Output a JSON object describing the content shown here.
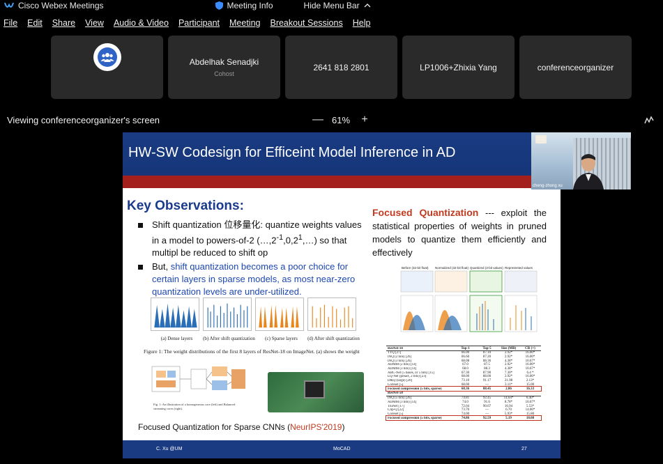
{
  "titlebar": {
    "app_name": "Cisco Webex Meetings",
    "meeting_info": "Meeting Info",
    "hide_menu": "Hide Menu Bar"
  },
  "menubar": [
    {
      "label": "File"
    },
    {
      "label": "Edit"
    },
    {
      "label": "Share"
    },
    {
      "label": "View"
    },
    {
      "label": "Audio & Video"
    },
    {
      "label": "Participant"
    },
    {
      "label": "Meeting"
    },
    {
      "label": "Breakout Sessions"
    },
    {
      "label": "Help"
    }
  ],
  "participants": [
    {
      "name": "",
      "role": "",
      "icon": "group-icon"
    },
    {
      "name": "Abdelhak Senadjki",
      "role": "Cohost"
    },
    {
      "name": "2641 818 2801",
      "role": ""
    },
    {
      "name": "LP1006+Zhixia Yang",
      "role": ""
    },
    {
      "name": "conferenceorganizer",
      "role": ""
    }
  ],
  "viewbar": {
    "viewing_text": "Viewing conferenceorganizer's screen",
    "zoom_minus": "—",
    "zoom_level": "61%",
    "zoom_plus": "+"
  },
  "slide": {
    "title": "HW-SW Codesign for Efficeint Model Inference in AD",
    "key_observations": "Key Observations:",
    "bullet1_a": "Shift quantization 位移量化: quantize weights values in a model to powers-of-2 (…,2",
    "bullet1_sup1": "-1",
    "bullet1_b": ",0,2",
    "bullet1_sup2": "1",
    "bullet1_c": ",…) so that multipl be reduced to shift op",
    "bullet2_a": "But, ",
    "bullet2_b": "shift quantization becomes a poor choice for certain layers in sparse models, as most near-zero quantization levels are under-utilized.",
    "fq_title": "Focused Quantization",
    "fq_text": " --- exploit the statistical properties of weights in pruned models to quantize them efficiently and effectively",
    "fig_captions": [
      "(a) Dense layers",
      "(b) After shift quantization",
      "(c) Sparse layers",
      "(d) After shift quantization"
    ],
    "fig_caption": "Figure 1:  The weight distributions of the first 8 layers of ResNet-18 on ImageNet. (a) shows the weight",
    "diagram_caption": "Fig. 1: An illustration of a homogeneous core (left) and Balanced streaming cores (right).",
    "fqs_text": "Focused Quantization for Sparse CNNs (",
    "fqs_venue": "NeurIPS'2019",
    "fqs_close": ")",
    "footer_left": "C. Xu @UM",
    "footer_mid": "MoCAD",
    "footer_right": "27"
  },
  "quant_fig_labels": [
    "Before (32-bit float)",
    "Normalized (32-bit float)",
    "Quantized (3-bit values)",
    "Represented values"
  ],
  "table": {
    "headers1": [
      "ResNet-18",
      "Top-1",
      "Top-5",
      "Size (MB)",
      "CR (×)"
    ],
    "rows1": [
      [
        "TTQ [27]",
        "66.00",
        "87.10",
        "2.92*",
        "16.00*"
      ],
      [
        "INQ (2 bits) [26]",
        "66.60",
        "87.20",
        "2.92*",
        "16.00*"
      ],
      [
        "INQ (3 bits) [26]",
        "68.08",
        "88.36",
        "4.38*",
        "10.67*"
      ],
      [
        "ADMM (2 bits) [14]",
        "67.0",
        "87.5",
        "2.92*",
        "16.00*"
      ],
      [
        "ADMM (3 bits) [14]",
        "68.0",
        "88.3",
        "4.38*",
        "10.67*"
      ],
      [
        "ABC-Net (5 bases, or 5 bits) [15]",
        "67.30",
        "87.90",
        "7.30*",
        "6.4 *"
      ],
      [
        "LQ-Net (preact, 2 bits) [23]",
        "68.00",
        "88.00",
        "2.92*",
        "16.00*"
      ],
      [
        "D&Q (large) [20]",
        "73.10",
        "91.17",
        "21.98",
        "2.13*"
      ],
      [
        "Coreset [5]",
        "68.00",
        "—",
        "3.11*",
        "15.00"
      ]
    ],
    "highlight1": [
      "Focused compression (5 bits, sparse)",
      "68.36",
      "88.45",
      "2.86",
      "16.33"
    ],
    "headers2": [
      "ResNet-50",
      "",
      "",
      "",
      ""
    ],
    "rows2": [
      [
        "INQ (5 bits) [26]",
        "74.81",
        "92.45",
        "14.64*",
        "6.40*"
      ],
      [
        "ADMM (3 bits) [14]",
        "74.0",
        "91.6",
        "8.78*",
        "10.67*"
      ],
      [
        "ThiNet [17]",
        "72.04",
        "90.67",
        "16.94",
        "5.53*"
      ],
      [
        "Clip-Q [22]",
        "73.70",
        "—",
        "6.70",
        "14.00*"
      ],
      [
        "Coreset [5]",
        "74.00",
        "—",
        "5.93*",
        "15.80"
      ]
    ],
    "highlight2": [
      "Focused compression (5 bits, sparse)",
      "74.86",
      "92.59",
      "5.19",
      "18.08"
    ]
  },
  "video": {
    "label": "cheng-zhong xu"
  }
}
